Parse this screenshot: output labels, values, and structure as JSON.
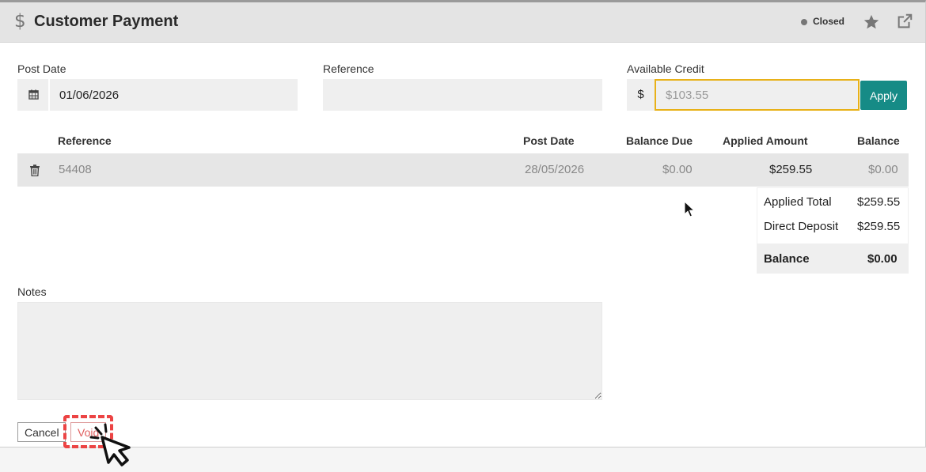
{
  "header": {
    "title": "Customer Payment",
    "status": "Closed",
    "status_color": "#777777",
    "icons": [
      "dollar-icon",
      "star-icon",
      "external-link-icon"
    ]
  },
  "form": {
    "post_date_label": "Post Date",
    "post_date_value": "01/06/2026",
    "reference_label": "Reference",
    "reference_value": "",
    "available_credit_label": "Available Credit",
    "currency_symbol": "$",
    "available_credit_placeholder": "$103.55",
    "apply_label": "Apply"
  },
  "table": {
    "columns": [
      "Reference",
      "Post Date",
      "Balance Due",
      "Applied Amount",
      "Balance"
    ],
    "rows": [
      {
        "reference": "54408",
        "post_date": "28/05/2026",
        "balance_due": "$0.00",
        "applied_amount": "$259.55",
        "balance": "$0.00"
      }
    ]
  },
  "totals": {
    "applied_total_label": "Applied Total",
    "applied_total_value": "$259.55",
    "direct_deposit_label": "Direct Deposit",
    "direct_deposit_value": "$259.55",
    "balance_label": "Balance",
    "balance_value": "$0.00"
  },
  "notes": {
    "label": "Notes",
    "value": ""
  },
  "actions": {
    "cancel_label": "Cancel",
    "void_label": "Void"
  },
  "colors": {
    "accent": "#168b86",
    "focus_border": "#e8b118",
    "highlight": "#ec4444"
  }
}
